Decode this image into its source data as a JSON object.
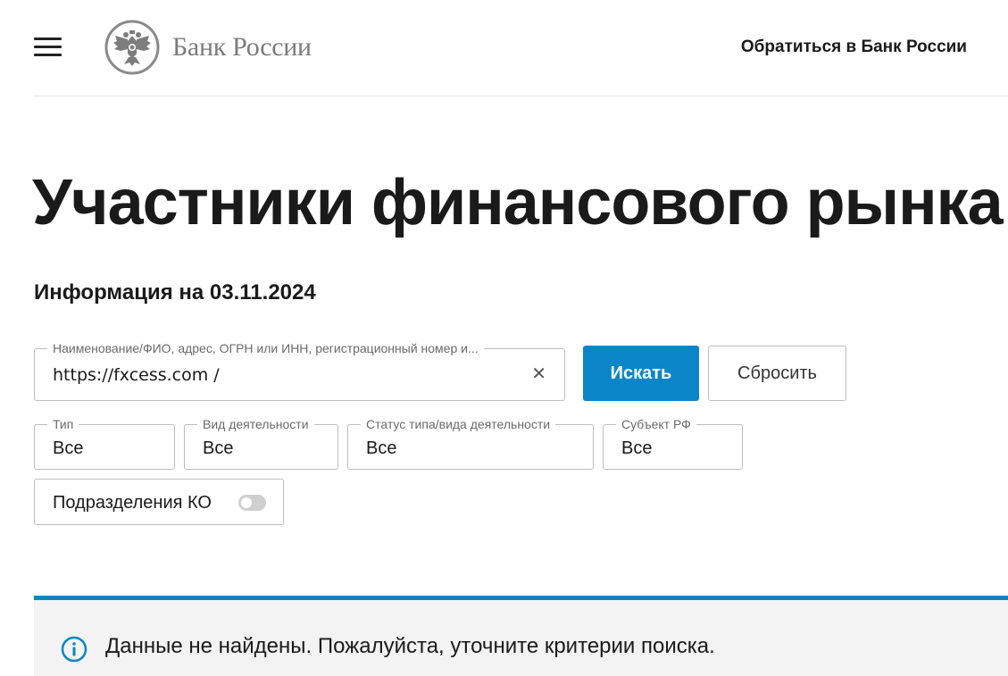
{
  "header": {
    "menu_icon": "hamburger-menu-icon",
    "logo_icon": "double-headed-eagle-emblem",
    "logo_text": "Банк России",
    "contact_link": "Обратиться в Банк России"
  },
  "main": {
    "title": "Участники финансового рынка",
    "info_date": "Информация на 03.11.2024"
  },
  "search": {
    "label": "Наименование/ФИО, адрес, ОГРН или ИНН, регистрационный номер и...",
    "value": "https://fxcess.com /",
    "clear_icon": "close-icon",
    "search_button": "Искать",
    "reset_button": "Сбросить"
  },
  "filters": [
    {
      "label": "Тип",
      "value": "Все"
    },
    {
      "label": "Вид деятельности",
      "value": "Все"
    },
    {
      "label": "Статус типа/вида деятельности",
      "value": "Все"
    },
    {
      "label": "Субъект РФ",
      "value": "Все"
    }
  ],
  "toggle": {
    "label": "Подразделения КО",
    "checked": false
  },
  "notice": {
    "icon": "info-icon",
    "text": "Данные не найдены. Пожалуйста, уточните критерии поиска."
  },
  "colors": {
    "accent": "#0a86c8",
    "text": "#1a1a1a",
    "logo_gray": "#7b7b7b",
    "notice_bg": "#f3f3f3",
    "border": "#bdbdbd"
  }
}
